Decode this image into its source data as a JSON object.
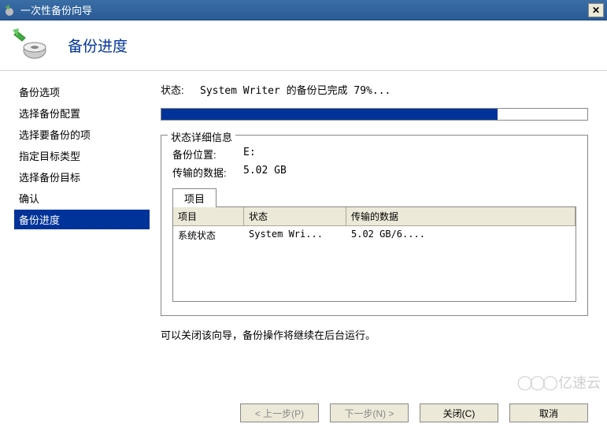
{
  "window": {
    "title": "一次性备份向导",
    "close_label": "✕"
  },
  "header": {
    "title": "备份进度"
  },
  "sidebar": {
    "items": [
      {
        "label": "备份选项"
      },
      {
        "label": "选择备份配置"
      },
      {
        "label": "选择要备份的项"
      },
      {
        "label": "指定目标类型"
      },
      {
        "label": "选择备份目标"
      },
      {
        "label": "确认"
      },
      {
        "label": "备份进度",
        "active": true
      }
    ]
  },
  "content": {
    "status_label": "状态:",
    "status_value": "System Writer 的备份已完成 79%...",
    "progress_percent": 79,
    "groupbox_title": "状态详细信息",
    "backup_location_label": "备份位置:",
    "backup_location_value": "E:",
    "data_transferred_label": "传输的数据:",
    "data_transferred_value": "5.02 GB",
    "tab_label": "项目",
    "table": {
      "headers": {
        "c1": "项目",
        "c2": "状态",
        "c3": "传输的数据"
      },
      "rows": [
        {
          "c1": "系统状态",
          "c2": "System Wri...",
          "c3": "5.02 GB/6...."
        }
      ]
    },
    "note": "可以关闭该向导，备份操作将继续在后台运行。"
  },
  "buttons": {
    "prev": "< 上一步(P)",
    "next": "下一步(N) >",
    "close": "关闭(C)",
    "cancel": "取消"
  },
  "watermark": {
    "text": "亿速云"
  }
}
